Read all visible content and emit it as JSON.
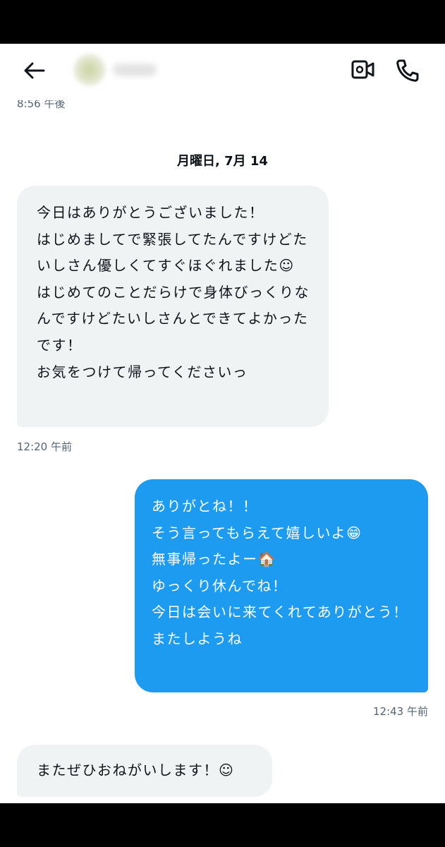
{
  "header": {
    "back_icon": "arrow-left-icon",
    "video_icon": "video-camera-icon",
    "call_icon": "phone-icon"
  },
  "previous_timestamp": "8:56 午後",
  "date_separator": "月曜日, 7月 14",
  "messages": [
    {
      "direction": "incoming",
      "text": "今日はありがとうございました！\nはじめましてで緊張してたんですけどたいしさん優しくてすぐほぐれました☺\nはじめてのことだらけで身体びっくりなんですけどたいしさんとできてよかったです！\nお気をつけて帰ってくださいっ",
      "time": "12:20 午前"
    },
    {
      "direction": "outgoing",
      "text": "ありがとね！！\nそう言ってもらえて嬉しいよ😁\n無事帰ったよー🏠\nゆっくり休んでね！\n今日は会いに来てくれてありがとう！\nまたしようね",
      "time": "12:43 午前"
    },
    {
      "direction": "incoming",
      "text": "またぜひおねがいします！☺"
    }
  ],
  "colors": {
    "outgoing_bubble": "#1d9bf0",
    "incoming_bubble": "#eff3f4",
    "timestamp": "#536471",
    "text": "#0f1419"
  }
}
